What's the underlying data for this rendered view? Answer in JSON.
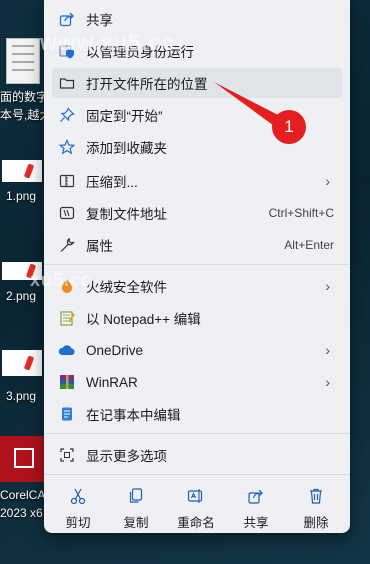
{
  "desktop": {
    "doc_text_line1": "面的数字",
    "doc_text_line2": "本号,越大",
    "files": [
      "1.png",
      "2.png",
      "3.png"
    ],
    "corel_line1": "CorelCA",
    "corel_line2": "2023 x6"
  },
  "watermarks": {
    "top": "www.xu5.cc",
    "mid": "xu5.cc"
  },
  "menu": {
    "items": [
      {
        "label": "共享",
        "icon": "share-icon"
      },
      {
        "label": "以管理员身份运行",
        "icon": "admin-shield-icon"
      },
      {
        "label": "打开文件所在的位置",
        "icon": "folder-icon"
      },
      {
        "label": "固定到“开始”",
        "icon": "pin-icon"
      },
      {
        "label": "添加到收藏夹",
        "icon": "star-icon"
      },
      {
        "label": "压缩到...",
        "icon": "zip-icon",
        "submenu": true
      },
      {
        "label": "复制文件地址",
        "icon": "copy-path-icon",
        "shortcut": "Ctrl+Shift+C"
      },
      {
        "label": "属性",
        "icon": "wrench-icon",
        "shortcut": "Alt+Enter"
      },
      {
        "label": "火绒安全软件",
        "icon": "huorong-icon",
        "submenu": true
      },
      {
        "label": "以 Notepad++ 编辑",
        "icon": "notepadpp-icon"
      },
      {
        "label": "OneDrive",
        "icon": "cloud-icon",
        "submenu": true
      },
      {
        "label": "WinRAR",
        "icon": "winrar-icon",
        "submenu": true
      },
      {
        "label": "在记事本中编辑",
        "icon": "notepad-icon"
      },
      {
        "label": "显示更多选项",
        "icon": "more-options-icon"
      }
    ],
    "actions": [
      {
        "label": "剪切",
        "icon": "scissors-icon"
      },
      {
        "label": "复制",
        "icon": "copy-icon"
      },
      {
        "label": "重命名",
        "icon": "rename-icon"
      },
      {
        "label": "共享",
        "icon": "share-icon"
      },
      {
        "label": "删除",
        "icon": "trash-icon"
      }
    ]
  },
  "annotation": {
    "number": "1",
    "color": "#e51f1f"
  }
}
